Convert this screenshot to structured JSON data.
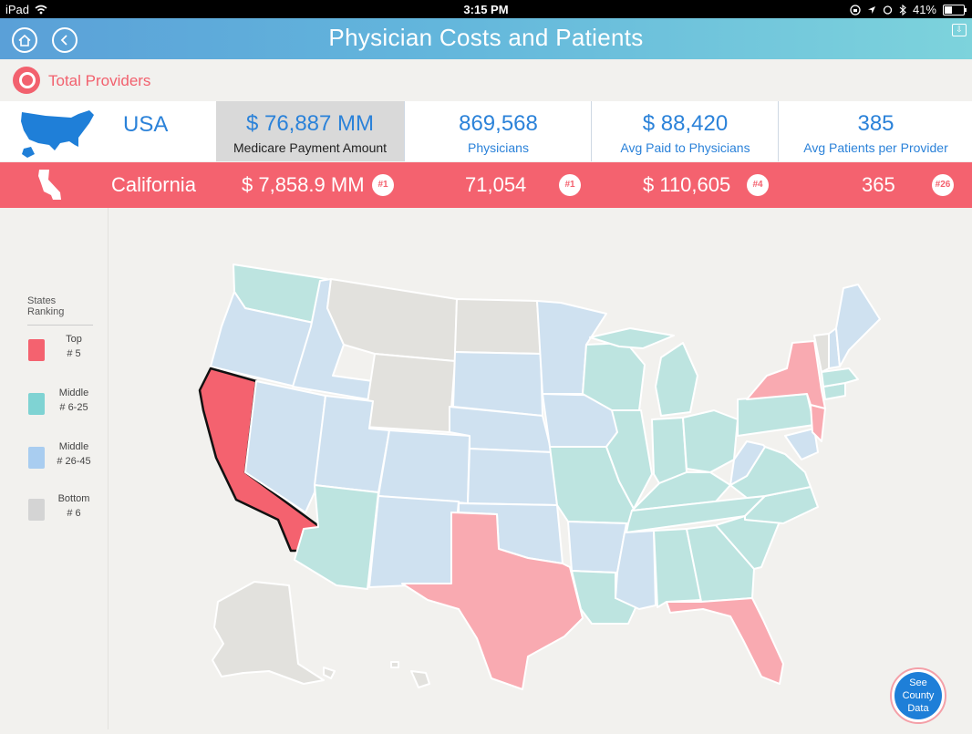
{
  "status": {
    "device": "iPad",
    "time": "3:15 PM",
    "battery": "41%"
  },
  "nav": {
    "title": "Physician Costs and Patients"
  },
  "providers": {
    "label": "Total Providers"
  },
  "usa": {
    "label": "USA",
    "stats": [
      {
        "value": "$ 76,887 MM",
        "caption": "Medicare Payment Amount",
        "selected": true
      },
      {
        "value": "869,568",
        "caption": "Physicians"
      },
      {
        "value": "$ 88,420",
        "caption": "Avg Paid to Physicians"
      },
      {
        "value": "385",
        "caption": "Avg Patients per Provider"
      }
    ]
  },
  "state": {
    "name": "California",
    "stats": [
      {
        "value": "$ 7,858.9 MM",
        "rank": "#1"
      },
      {
        "value": "71,054",
        "rank": "#1"
      },
      {
        "value": "$ 110,605",
        "rank": "#4"
      },
      {
        "value": "365",
        "rank": "#26"
      }
    ]
  },
  "legend": {
    "title": "States Ranking",
    "items": [
      {
        "line1": "Top",
        "line2": "# 5",
        "color": "#f4626f"
      },
      {
        "line1": "Middle",
        "line2": "# 6-25",
        "color": "#7fd3d3"
      },
      {
        "line1": "Middle",
        "line2": "# 26-45",
        "color": "#a9cdf0"
      },
      {
        "line1": "Bottom",
        "line2": "# 6",
        "color": "#d4d4d4"
      }
    ]
  },
  "map_colors": {
    "top": "#f9aab1",
    "selected": "#f4626f",
    "mid_high": "#bde4e0",
    "mid_low": "#cfe1f0",
    "bottom": "#e2e1dd"
  },
  "county_button": {
    "line1": "See",
    "line2": "County",
    "line3": "Data"
  }
}
